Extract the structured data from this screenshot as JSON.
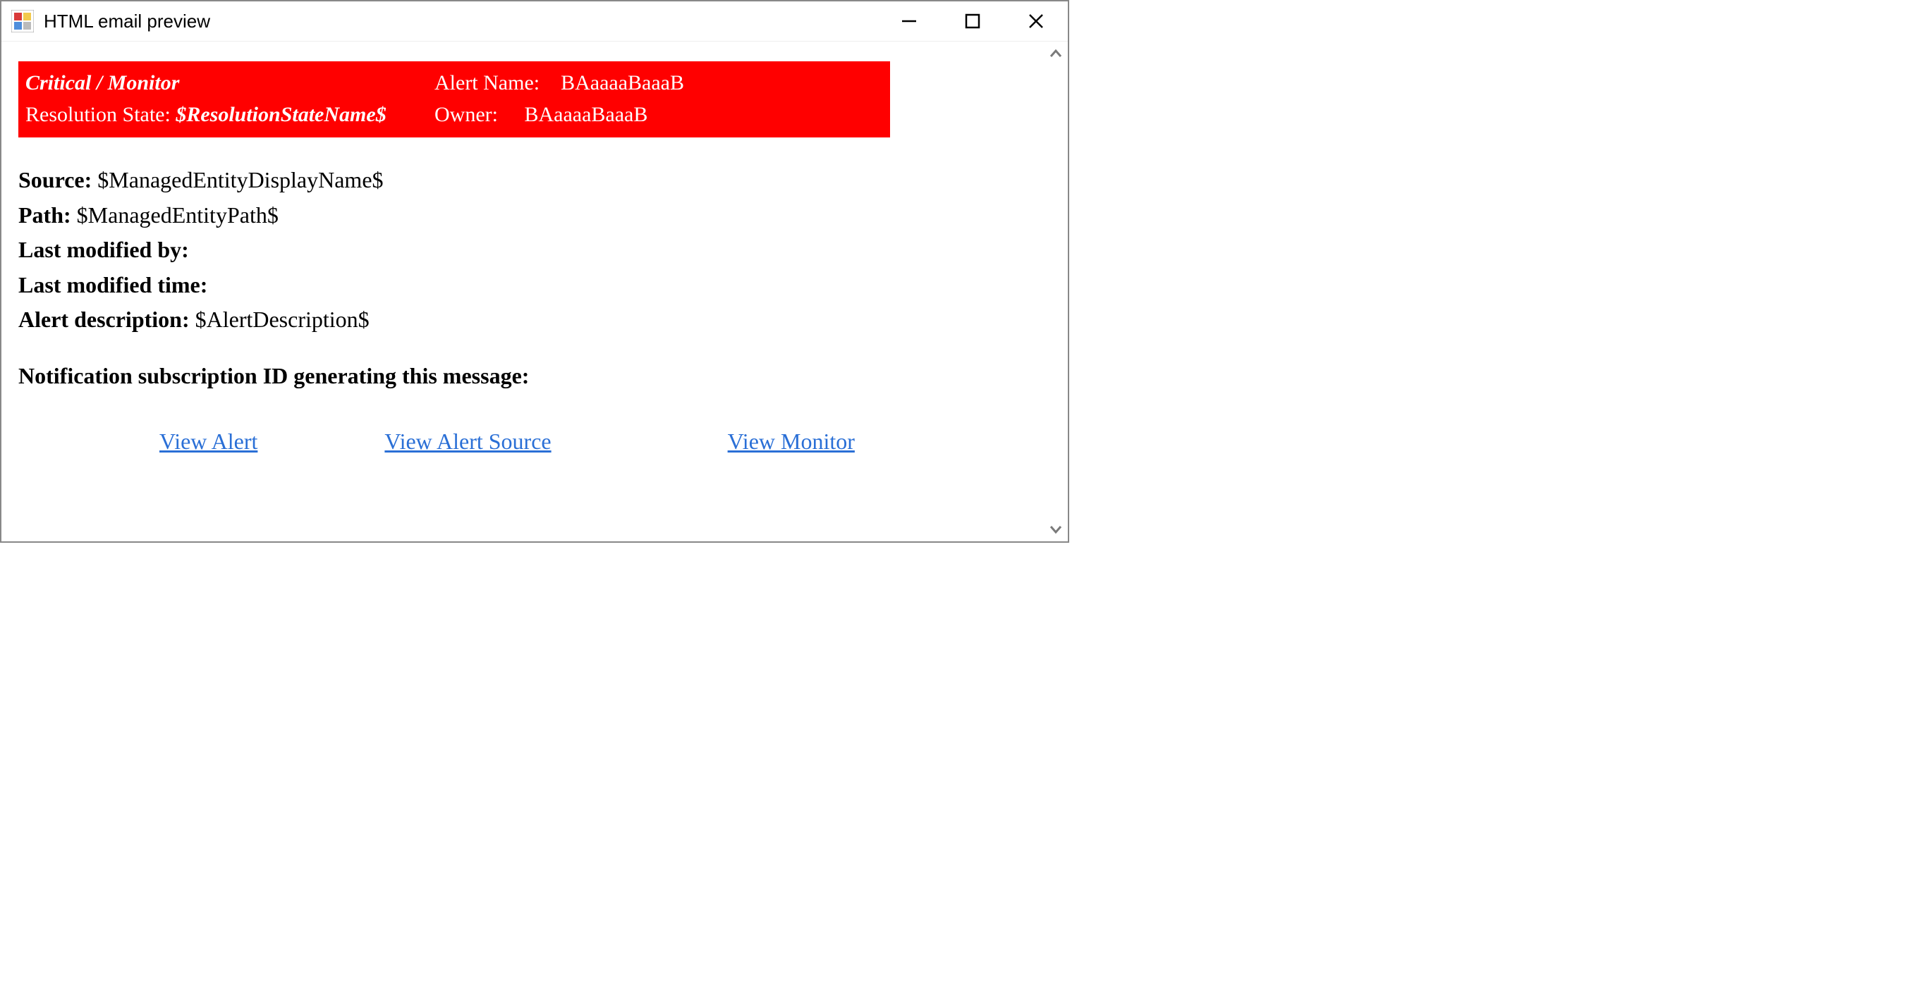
{
  "window": {
    "title": "HTML email preview"
  },
  "header": {
    "severity_source": "Critical / Monitor",
    "alert_name_label": "Alert Name:",
    "alert_name_value": "BAaaaaBaaaB",
    "resolution_label": "Resolution State:",
    "resolution_value": "$ResolutionStateName$",
    "owner_label": "Owner:",
    "owner_value": "BAaaaaBaaaB"
  },
  "body": {
    "source_label": "Source:",
    "source_value": "$ManagedEntityDisplayName$",
    "path_label": "Path:",
    "path_value": "$ManagedEntityPath$",
    "last_modified_by_label": "Last modified by:",
    "last_modified_by_value": "",
    "last_modified_time_label": "Last modified time:",
    "last_modified_time_value": "",
    "alert_description_label": "Alert description:",
    "alert_description_value": "$AlertDescription$"
  },
  "subscription": {
    "label": "Notification subscription ID generating this message:",
    "value": ""
  },
  "links": {
    "view_alert": "View Alert",
    "view_alert_source": "View Alert Source",
    "view_monitor": "View Monitor"
  },
  "colors": {
    "header_bg": "#ff0000",
    "link": "#2a6fd6"
  }
}
